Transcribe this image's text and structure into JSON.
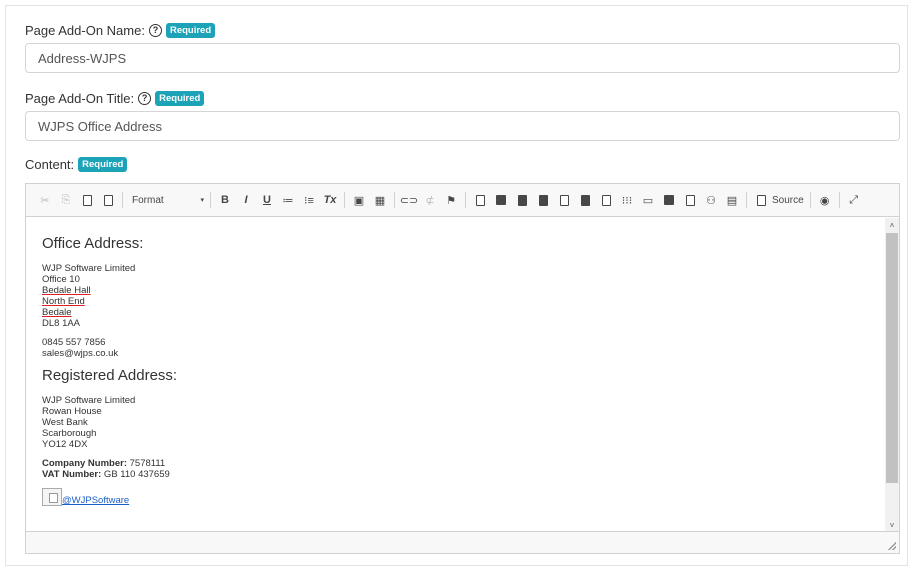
{
  "fields": {
    "name": {
      "label": "Page Add-On Name:",
      "badge": "Required",
      "value": "Address-WJPS"
    },
    "title": {
      "label": "Page Add-On Title:",
      "badge": "Required",
      "value": "WJPS Office Address"
    },
    "content": {
      "label": "Content:",
      "badge": "Required"
    }
  },
  "help_icon_glyph": "?",
  "toolbar": {
    "format_label": "Format",
    "format_arrow": "▾",
    "source_label": "Source",
    "icons": [
      "cut-icon",
      "copy-icon",
      "paste-icon",
      "paste-text-icon",
      "bold-icon",
      "italic-icon",
      "underline-icon",
      "numbered-list-icon",
      "bulleted-list-icon",
      "remove-format-icon",
      "image-icon",
      "table-icon",
      "link-icon",
      "unlink-icon",
      "anchor-icon",
      "template-icon",
      "source-icon",
      "accessibility-icon",
      "maximize-icon"
    ],
    "glyphs": {
      "cut": "✂",
      "copy": "⎘",
      "bold": "B",
      "italic": "I",
      "underline": "U",
      "remove_format": "Tx",
      "numbered": "≔",
      "bulleted": "⁝≡",
      "image": "▣",
      "table": "▦",
      "link": "⊂⊃",
      "unlink": "⊄",
      "anchor": "⚑",
      "grid": "⁝⁝⁝",
      "comment": "▭",
      "people": "⚇",
      "calendar": "▤",
      "accessibility": "◉",
      "maximize": "⤢"
    }
  },
  "editor_content": {
    "office_heading": "Office Address:",
    "office_lines": [
      "WJP Software Limited",
      "Office 10",
      "Bedale Hall",
      "North End",
      "Bedale",
      "DL8 1AA"
    ],
    "phone": "0845 557 7856",
    "email": "sales@wjps.co.uk",
    "registered_heading": "Registered Address:",
    "registered_lines": [
      "WJP Software Limited",
      "Rowan House",
      "West Bank",
      "Scarborough",
      "YO12 4DX"
    ],
    "company_number_label": "Company Number:",
    "company_number": " 7578111",
    "vat_label": "VAT Number:",
    "vat_number": " GB 110 437659",
    "twitter_link": "@WJPSoftware"
  },
  "scroll_arrows": {
    "up": "˄",
    "down": "˅"
  },
  "colors": {
    "badge": "#1da3b7",
    "link": "#1a5ec9"
  }
}
